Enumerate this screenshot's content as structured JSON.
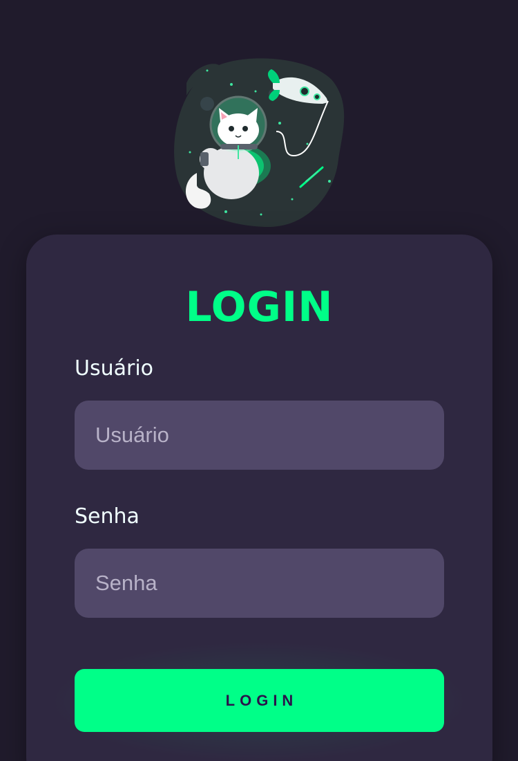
{
  "login": {
    "title": "LOGIN",
    "username_label": "Usuário",
    "username_placeholder": "Usuário",
    "password_label": "Senha",
    "password_placeholder": "Senha",
    "submit_label": "LOGIN"
  },
  "illustration": {
    "icon": "astronaut-cat-illustration"
  },
  "colors": {
    "background": "#201b2c",
    "card": "#2f2841",
    "input": "#514869",
    "accent": "#00ff88",
    "button_text": "#2b134b",
    "label_text": "#f0ffff"
  }
}
